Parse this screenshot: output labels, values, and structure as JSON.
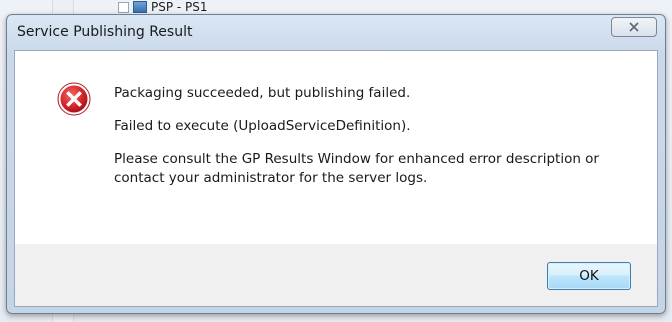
{
  "background": {
    "tree_item_label": "PSP - PS1"
  },
  "dialog": {
    "title": "Service Publishing Result",
    "close_glyph": "✕",
    "icon": "error-icon",
    "messages": [
      "Packaging succeeded, but publishing failed.",
      "Failed to execute (UploadServiceDefinition).",
      "Please consult the GP Results Window for enhanced error description or contact your administrator for the server logs."
    ],
    "ok_label": "OK"
  },
  "colors": {
    "error_red": "#d7262b",
    "ok_border": "#3c7fb1",
    "title_bar": "#c9d8ea"
  }
}
